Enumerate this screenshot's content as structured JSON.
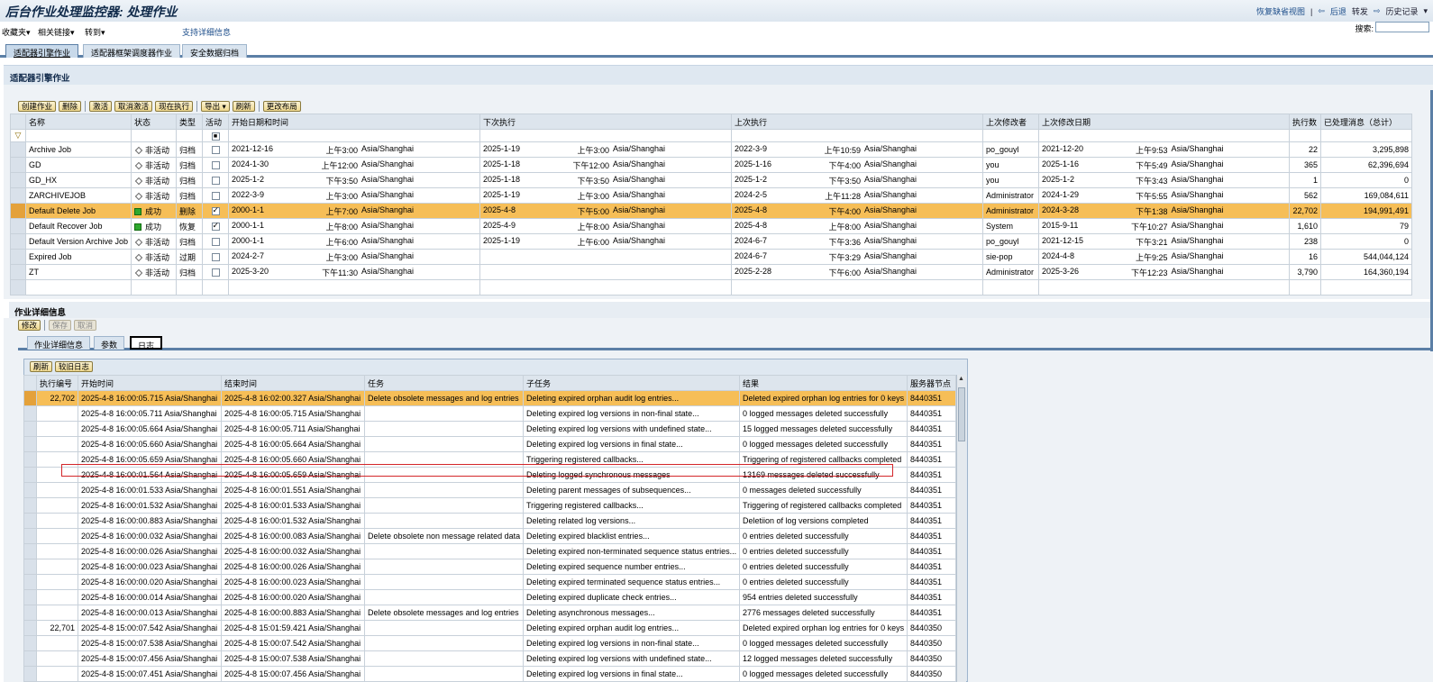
{
  "app": {
    "title": "后台作业处理监控器: 处理作业"
  },
  "topright": {
    "restore": "恢复缺省视图",
    "sep": "|",
    "back": "后退",
    "forward": "转发",
    "history": "历史记录"
  },
  "menu": {
    "favorites": "收藏夹",
    "links": "相关链接",
    "goto": "转到",
    "support": "支持详细信息",
    "search_label": "搜索:",
    "search_value": ""
  },
  "tabs": [
    "适配器引擎作业",
    "适配器框架调度器作业",
    "安全数据归档"
  ],
  "panel": {
    "title": "适配器引擎作业"
  },
  "jobs_toolbar": [
    "创建作业",
    "删除",
    "激活",
    "取消激活",
    "现在执行",
    "导出",
    "刷新",
    "更改布局"
  ],
  "jobs_columns": [
    "名称",
    "状态",
    "类型",
    "活动",
    "开始日期和时间",
    "下次执行",
    "上次执行",
    "上次修改者",
    "上次修改日期",
    "执行数",
    "已处理消息（总计）"
  ],
  "jobs": [
    {
      "name": "Archive Job",
      "status": "非活动",
      "status_icon": "diamond",
      "type": "归档",
      "active": false,
      "start": [
        "2021-12-16",
        "上午3:00",
        "Asia/Shanghai"
      ],
      "next": [
        "2025-1-19",
        "上午3:00",
        "Asia/Shanghai"
      ],
      "last": [
        "2022-3-9",
        "上午10:59",
        "Asia/Shanghai"
      ],
      "modifier": "po_gouyl",
      "moddate": [
        "2021-12-20",
        "上午9:53",
        "Asia/Shanghai"
      ],
      "count": "22",
      "messages": "3,295,898"
    },
    {
      "name": "GD",
      "status": "非活动",
      "status_icon": "diamond",
      "type": "归档",
      "active": false,
      "start": [
        "2024-1-30",
        "上午12:00",
        "Asia/Shanghai"
      ],
      "next": [
        "2025-1-18",
        "下午12:00",
        "Asia/Shanghai"
      ],
      "last": [
        "2025-1-16",
        "下午4:00",
        "Asia/Shanghai"
      ],
      "modifier": "you",
      "moddate": [
        "2025-1-16",
        "下午5:49",
        "Asia/Shanghai"
      ],
      "count": "365",
      "messages": "62,396,694"
    },
    {
      "name": "GD_HX",
      "status": "非活动",
      "status_icon": "diamond",
      "type": "归档",
      "active": false,
      "start": [
        "2025-1-2",
        "下午3:50",
        "Asia/Shanghai"
      ],
      "next": [
        "2025-1-18",
        "下午3:50",
        "Asia/Shanghai"
      ],
      "last": [
        "2025-1-2",
        "下午3:50",
        "Asia/Shanghai"
      ],
      "modifier": "you",
      "moddate": [
        "2025-1-2",
        "下午3:43",
        "Asia/Shanghai"
      ],
      "count": "1",
      "messages": "0"
    },
    {
      "name": "ZARCHIVEJOB",
      "status": "非活动",
      "status_icon": "diamond",
      "type": "归档",
      "active": false,
      "start": [
        "2022-3-9",
        "上午3:00",
        "Asia/Shanghai"
      ],
      "next": [
        "2025-1-19",
        "上午3:00",
        "Asia/Shanghai"
      ],
      "last": [
        "2024-2-5",
        "上午11:28",
        "Asia/Shanghai"
      ],
      "modifier": "Administrator",
      "moddate": [
        "2024-1-29",
        "下午5:55",
        "Asia/Shanghai"
      ],
      "count": "562",
      "messages": "169,084,611"
    },
    {
      "name": "Default Delete Job",
      "status": "成功",
      "status_icon": "green",
      "type": "删除",
      "active": true,
      "highlight": true,
      "start": [
        "2000-1-1",
        "上午7:00",
        "Asia/Shanghai"
      ],
      "next": [
        "2025-4-8",
        "下午5:00",
        "Asia/Shanghai"
      ],
      "last": [
        "2025-4-8",
        "下午4:00",
        "Asia/Shanghai"
      ],
      "modifier": "Administrator",
      "moddate": [
        "2024-3-28",
        "下午1:38",
        "Asia/Shanghai"
      ],
      "count": "22,702",
      "messages": "194,991,491"
    },
    {
      "name": "Default Recover Job",
      "status": "成功",
      "status_icon": "green",
      "type": "恢复",
      "active": true,
      "start": [
        "2000-1-1",
        "上午8:00",
        "Asia/Shanghai"
      ],
      "next": [
        "2025-4-9",
        "上午8:00",
        "Asia/Shanghai"
      ],
      "last": [
        "2025-4-8",
        "上午8:00",
        "Asia/Shanghai"
      ],
      "modifier": "System",
      "moddate": [
        "2015-9-11",
        "下午10:27",
        "Asia/Shanghai"
      ],
      "count": "1,610",
      "messages": "79"
    },
    {
      "name": "Default Version Archive Job",
      "status": "非活动",
      "status_icon": "diamond",
      "type": "归档",
      "active": false,
      "start": [
        "2000-1-1",
        "上午6:00",
        "Asia/Shanghai"
      ],
      "next": [
        "2025-1-19",
        "上午6:00",
        "Asia/Shanghai"
      ],
      "last": [
        "2024-6-7",
        "下午3:36",
        "Asia/Shanghai"
      ],
      "modifier": "po_gouyl",
      "moddate": [
        "2021-12-15",
        "下午3:21",
        "Asia/Shanghai"
      ],
      "count": "238",
      "messages": "0"
    },
    {
      "name": "Expired Job",
      "status": "非活动",
      "status_icon": "diamond",
      "type": "过期",
      "active": false,
      "start": [
        "2024-2-7",
        "上午3:00",
        "Asia/Shanghai"
      ],
      "next": [
        "",
        "",
        ""
      ],
      "last": [
        "2024-6-7",
        "下午3:29",
        "Asia/Shanghai"
      ],
      "modifier": "sie-pop",
      "moddate": [
        "2024-4-8",
        "上午9:25",
        "Asia/Shanghai"
      ],
      "count": "16",
      "messages": "544,044,124"
    },
    {
      "name": "ZT",
      "status": "非活动",
      "status_icon": "diamond",
      "type": "归档",
      "active": false,
      "start": [
        "2025-3-20",
        "下午11:30",
        "Asia/Shanghai"
      ],
      "next": [
        "",
        "",
        ""
      ],
      "last": [
        "2025-2-28",
        "下午6:00",
        "Asia/Shanghai"
      ],
      "modifier": "Administrator",
      "moddate": [
        "2025-3-26",
        "下午12:23",
        "Asia/Shanghai"
      ],
      "count": "3,790",
      "messages": "164,360,194"
    }
  ],
  "detail": {
    "title": "作业详细信息",
    "buttons": [
      "修改",
      "保存",
      "取消"
    ],
    "tabs": [
      "作业详细信息",
      "参数",
      "日志"
    ]
  },
  "log_toolbar": [
    "刷新",
    "较旧日志"
  ],
  "log_columns": [
    "执行编号",
    "开始时间",
    "结束时间",
    "任务",
    "子任务",
    "结果",
    "服务器节点"
  ],
  "log_rows": [
    {
      "no": "22,702",
      "start": "2025-4-8 16:00:05.715 Asia/Shanghai",
      "end": "2025-4-8 16:02:00.327 Asia/Shanghai",
      "task": "Delete obsolete messages and log entries",
      "sub": "Deleting expired orphan audit log entries...",
      "result": "Deleted expired orphan log entries for 0 keys",
      "node": "8440351",
      "highlight": true
    },
    {
      "no": "",
      "start": "2025-4-8 16:00:05.711 Asia/Shanghai",
      "end": "2025-4-8 16:00:05.715 Asia/Shanghai",
      "task": "",
      "sub": "Deleting expired log versions in non-final state...",
      "result": "0 logged messages deleted successfully",
      "node": "8440351"
    },
    {
      "no": "",
      "start": "2025-4-8 16:00:05.664 Asia/Shanghai",
      "end": "2025-4-8 16:00:05.711 Asia/Shanghai",
      "task": "",
      "sub": "Deleting expired log versions with undefined state...",
      "result": "15 logged messages deleted successfully",
      "node": "8440351"
    },
    {
      "no": "",
      "start": "2025-4-8 16:00:05.660 Asia/Shanghai",
      "end": "2025-4-8 16:00:05.664 Asia/Shanghai",
      "task": "",
      "sub": "Deleting expired log versions in final state...",
      "result": "0 logged messages deleted successfully",
      "node": "8440351"
    },
    {
      "no": "",
      "start": "2025-4-8 16:00:05.659 Asia/Shanghai",
      "end": "2025-4-8 16:00:05.660 Asia/Shanghai",
      "task": "",
      "sub": "Triggering registered callbacks...",
      "result": "Triggering of registered callbacks completed",
      "node": "8440351"
    },
    {
      "no": "",
      "start": "2025-4-8 16:00:01.564 Asia/Shanghai",
      "end": "2025-4-8 16:00:05.659 Asia/Shanghai",
      "task": "",
      "sub": "Deleting logged synchronous messages",
      "result": "13169 messages deleted successfully",
      "node": "8440351"
    },
    {
      "no": "",
      "start": "2025-4-8 16:00:01.533 Asia/Shanghai",
      "end": "2025-4-8 16:00:01.551 Asia/Shanghai",
      "task": "",
      "sub": "Deleting parent messages of subsequences...",
      "result": "0 messages deleted successfully",
      "node": "8440351"
    },
    {
      "no": "",
      "start": "2025-4-8 16:00:01.532 Asia/Shanghai",
      "end": "2025-4-8 16:00:01.533 Asia/Shanghai",
      "task": "",
      "sub": "Triggering registered callbacks...",
      "result": "Triggering of registered callbacks completed",
      "node": "8440351"
    },
    {
      "no": "",
      "start": "2025-4-8 16:00:00.883 Asia/Shanghai",
      "end": "2025-4-8 16:00:01.532 Asia/Shanghai",
      "task": "",
      "sub": "Deleting related log versions...",
      "result": "Deletiion of log versions completed",
      "node": "8440351"
    },
    {
      "no": "",
      "start": "2025-4-8 16:00:00.032 Asia/Shanghai",
      "end": "2025-4-8 16:00:00.083 Asia/Shanghai",
      "task": "Delete obsolete non message related data",
      "sub": "Deleting expired blacklist entries...",
      "result": "0 entries deleted successfully",
      "node": "8440351"
    },
    {
      "no": "",
      "start": "2025-4-8 16:00:00.026 Asia/Shanghai",
      "end": "2025-4-8 16:00:00.032 Asia/Shanghai",
      "task": "",
      "sub": "Deleting expired non-terminated sequence status entries...",
      "result": "0 entries deleted successfully",
      "node": "8440351"
    },
    {
      "no": "",
      "start": "2025-4-8 16:00:00.023 Asia/Shanghai",
      "end": "2025-4-8 16:00:00.026 Asia/Shanghai",
      "task": "",
      "sub": "Deleting expired sequence number entries...",
      "result": "0 entries deleted successfully",
      "node": "8440351"
    },
    {
      "no": "",
      "start": "2025-4-8 16:00:00.020 Asia/Shanghai",
      "end": "2025-4-8 16:00:00.023 Asia/Shanghai",
      "task": "",
      "sub": "Deleting expired terminated sequence status entries...",
      "result": "0 entries deleted successfully",
      "node": "8440351"
    },
    {
      "no": "",
      "start": "2025-4-8 16:00:00.014 Asia/Shanghai",
      "end": "2025-4-8 16:00:00.020 Asia/Shanghai",
      "task": "",
      "sub": "Deleting expired duplicate check entries...",
      "result": "954 entries deleted successfully",
      "node": "8440351"
    },
    {
      "no": "",
      "start": "2025-4-8 16:00:00.013 Asia/Shanghai",
      "end": "2025-4-8 16:00:00.883 Asia/Shanghai",
      "task": "Delete obsolete messages and log entries",
      "sub": "Deleting asynchronous messages...",
      "result": "2776 messages deleted successfully",
      "node": "8440351"
    },
    {
      "no": "22,701",
      "start": "2025-4-8 15:00:07.542 Asia/Shanghai",
      "end": "2025-4-8 15:01:59.421 Asia/Shanghai",
      "task": "",
      "sub": "Deleting expired orphan audit log entries...",
      "result": "Deleted expired orphan log entries for 0 keys",
      "node": "8440350"
    },
    {
      "no": "",
      "start": "2025-4-8 15:00:07.538 Asia/Shanghai",
      "end": "2025-4-8 15:00:07.542 Asia/Shanghai",
      "task": "",
      "sub": "Deleting expired log versions in non-final state...",
      "result": "0 logged messages deleted successfully",
      "node": "8440350"
    },
    {
      "no": "",
      "start": "2025-4-8 15:00:07.456 Asia/Shanghai",
      "end": "2025-4-8 15:00:07.538 Asia/Shanghai",
      "task": "",
      "sub": "Deleting expired log versions with undefined state...",
      "result": "12 logged messages deleted successfully",
      "node": "8440350"
    },
    {
      "no": "",
      "start": "2025-4-8 15:00:07.451 Asia/Shanghai",
      "end": "2025-4-8 15:00:07.456 Asia/Shanghai",
      "task": "",
      "sub": "Deleting expired log versions in final state...",
      "result": "0 logged messages deleted successfully",
      "node": "8440350"
    }
  ]
}
